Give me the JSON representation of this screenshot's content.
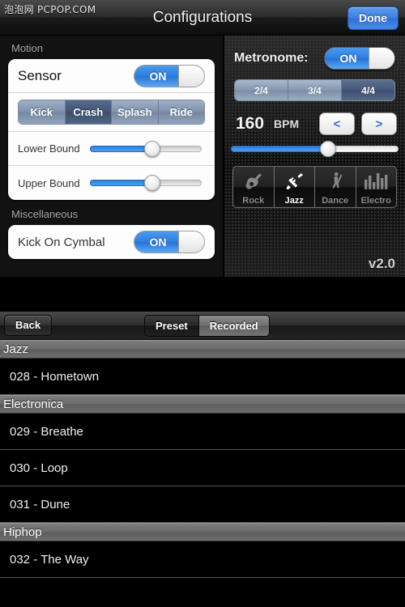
{
  "header": {
    "watermark": "泡泡网 PCPOP.COM",
    "title": "Configurations",
    "done_label": "Done"
  },
  "config": {
    "motion": {
      "group_label": "Motion",
      "sensor_label": "Sensor",
      "sensor_toggle": "ON",
      "pads": [
        {
          "label": "Kick",
          "selected": false
        },
        {
          "label": "Crash",
          "selected": true
        },
        {
          "label": "Splash",
          "selected": false
        },
        {
          "label": "Ride",
          "selected": false
        }
      ],
      "lower_bound_label": "Lower Bound",
      "lower_bound_percent": 56,
      "upper_bound_label": "Upper Bound",
      "upper_bound_percent": 56
    },
    "miscellaneous": {
      "group_label": "Miscellaneous",
      "kick_on_cymbal_label": "Kick On Cymbal",
      "kick_on_cymbal_toggle": "ON"
    },
    "metronome": {
      "label": "Metronome:",
      "toggle": "ON",
      "time_signatures": [
        {
          "label": "2/4",
          "selected": false
        },
        {
          "label": "3/4",
          "selected": false
        },
        {
          "label": "4/4",
          "selected": true
        }
      ],
      "bpm_value": "160",
      "bpm_unit": "BPM",
      "decrease_label": "<",
      "increase_label": ">",
      "bpm_slider_percent": 58
    },
    "genres": [
      {
        "label": "Rock",
        "icon": "guitar-icon",
        "selected": false
      },
      {
        "label": "Jazz",
        "icon": "trumpet-icon",
        "selected": true
      },
      {
        "label": "Dance",
        "icon": "dancer-icon",
        "selected": false
      },
      {
        "label": "Electro",
        "icon": "equalizer-icon",
        "selected": false
      }
    ],
    "version": "v2.0"
  },
  "list": {
    "back_label": "Back",
    "tabs": [
      {
        "label": "Preset",
        "selected": false
      },
      {
        "label": "Recorded",
        "selected": true
      }
    ],
    "sections": [
      {
        "title": "Jazz",
        "songs": [
          "028 - Hometown"
        ]
      },
      {
        "title": "Electronica",
        "songs": [
          "029 - Breathe",
          "030 - Loop",
          "031 - Dune"
        ]
      },
      {
        "title": "Hiphop",
        "songs": [
          "032 - The Way"
        ]
      }
    ]
  },
  "colors": {
    "accent_blue": "#2f7fe0",
    "done_blue": "#3d7de0",
    "section_gray": "#6a6a6a"
  }
}
